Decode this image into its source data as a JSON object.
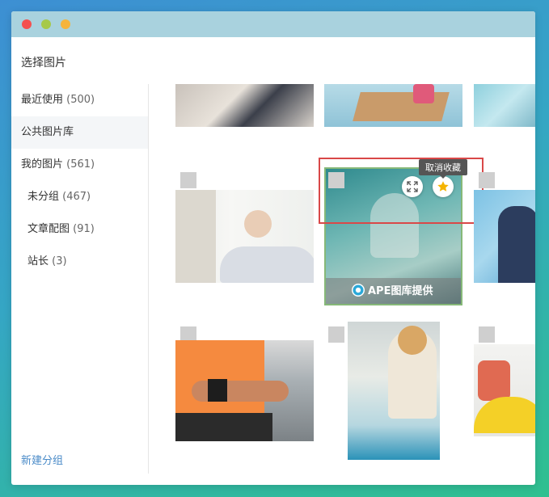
{
  "dialog": {
    "title": "选择图片"
  },
  "sidebar": {
    "items": [
      {
        "label": "最近使用",
        "count": "(500)"
      },
      {
        "label": "公共图片库",
        "count": ""
      },
      {
        "label": "我的图片",
        "count": "(561)"
      },
      {
        "label": "未分组",
        "count": "(467)"
      },
      {
        "label": "文章配图",
        "count": "(91)"
      },
      {
        "label": "站长",
        "count": "(3)"
      }
    ],
    "active_index": 1,
    "new_group_label": "新建分组"
  },
  "gallery": {
    "hovered_image": {
      "tooltip": "取消收藏",
      "watermark": "APE图库提供",
      "expand_icon": "expand-icon",
      "favorite_icon": "star-icon"
    }
  },
  "colors": {
    "accent_link": "#4a8bc8",
    "highlight": "#d94848",
    "star": "#f5b400",
    "selected_border": "#86b878"
  }
}
